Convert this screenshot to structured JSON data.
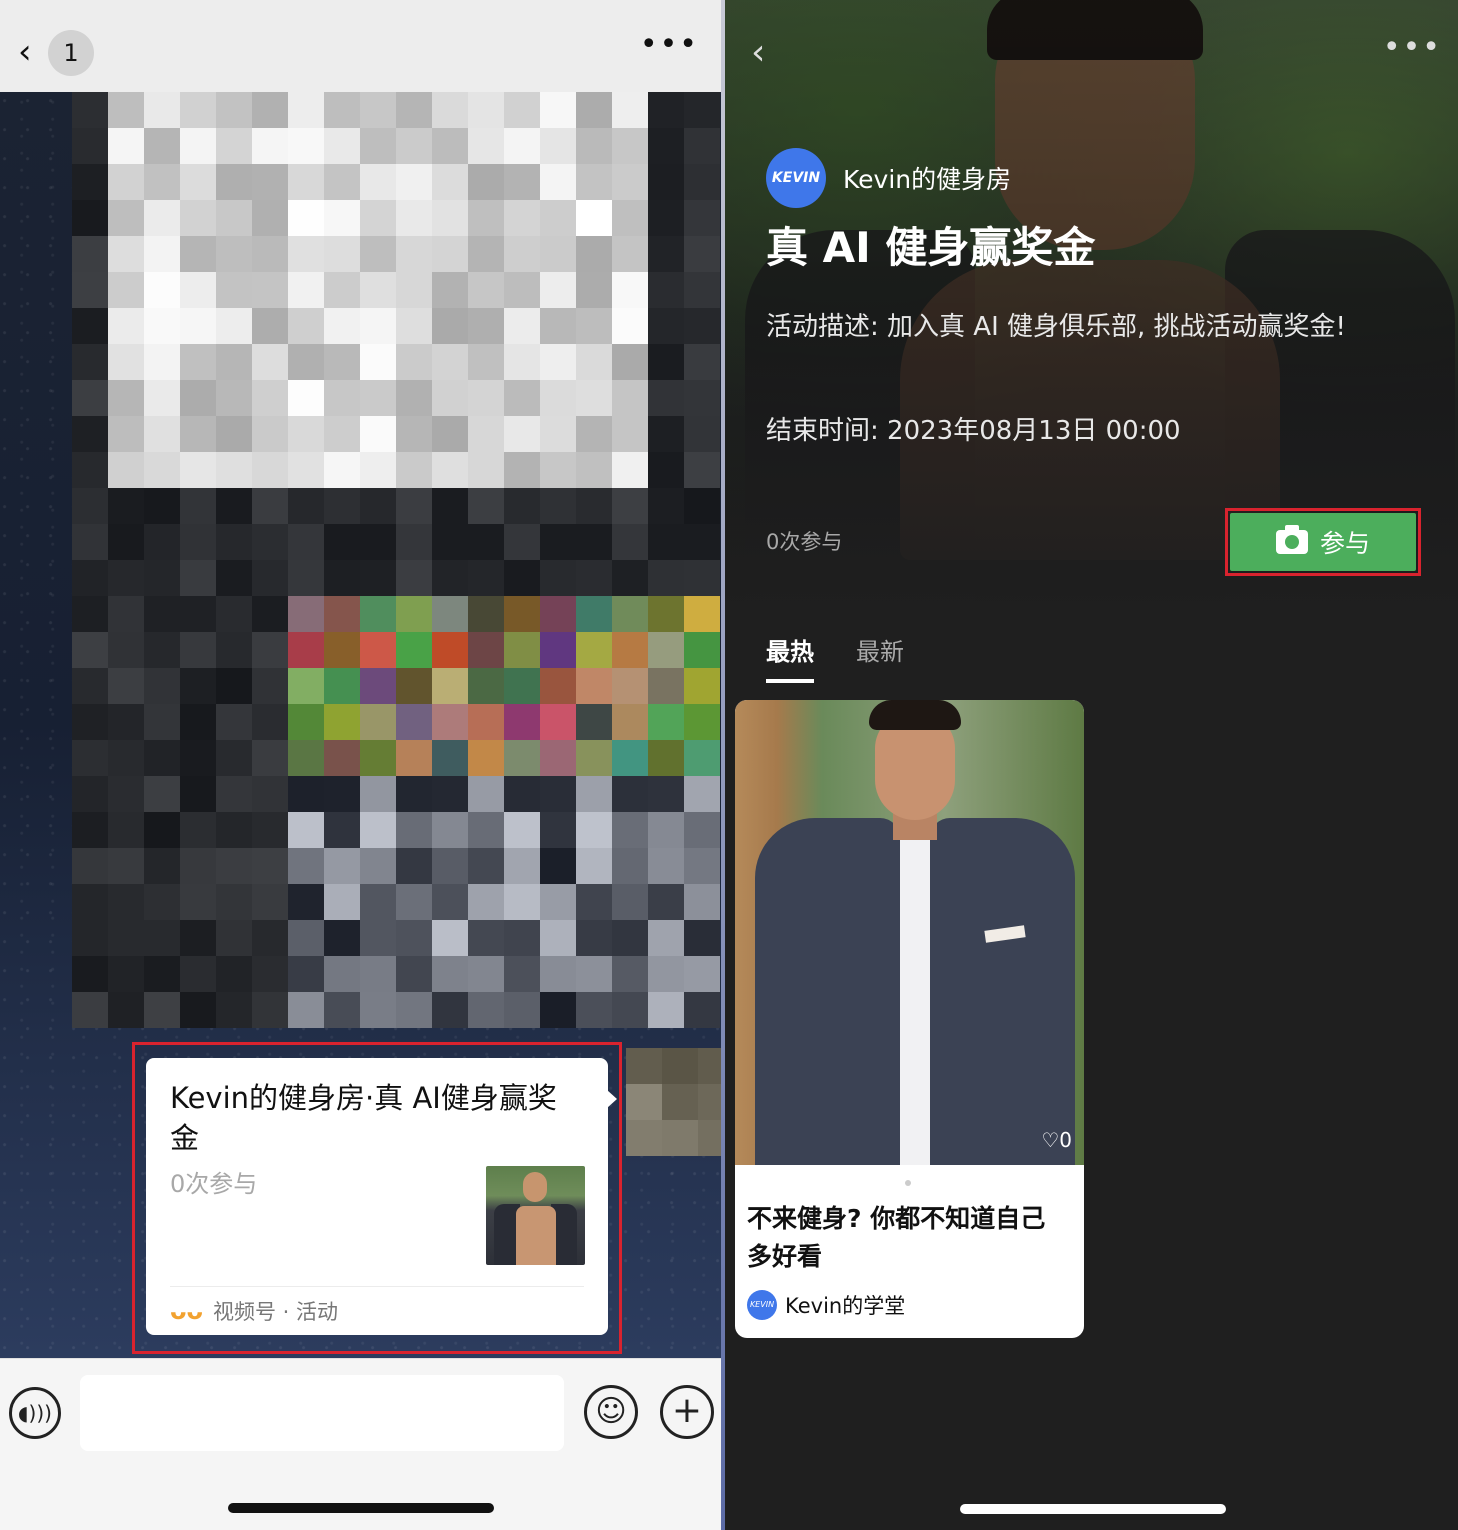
{
  "chat": {
    "header": {
      "back_glyph": "‹",
      "unread_count": "1",
      "more_glyph": "•••"
    },
    "card": {
      "title": "Kevin的健身房·真 AI健身赢奖金",
      "participants": "0次参与",
      "source": "视频号 · 活动",
      "source_icon": "channels-icon"
    },
    "input_bar": {
      "voice_icon": "voice-icon",
      "emoji_icon": "emoji-icon",
      "plus_icon": "plus-icon"
    }
  },
  "activity": {
    "header": {
      "back_glyph": "‹",
      "more_glyph": "•••"
    },
    "author": {
      "avatar_text": "KEVIN",
      "name": "Kevin的健身房"
    },
    "title": "真 AI 健身赢奖金",
    "description": "活动描述: 加入真 AI 健身俱乐部, 挑战活动赢奖金!",
    "end_time": "结束时间: 2023年08月13日 00:00",
    "participants": "0次参与",
    "join_button": "参与",
    "tabs": [
      {
        "label": "最热",
        "active": true
      },
      {
        "label": "最新",
        "active": false
      }
    ],
    "feed": [
      {
        "likes": "0",
        "title": "不来健身? 你都不知道自己多好看",
        "author_avatar": "KEVIN",
        "author": "Kevin的学堂"
      }
    ]
  },
  "colors": {
    "highlight_frame": "#d9232e",
    "join_green": "#4cae5c",
    "avatar_blue": "#3f77ea",
    "channels_orange": "#f2a230"
  }
}
